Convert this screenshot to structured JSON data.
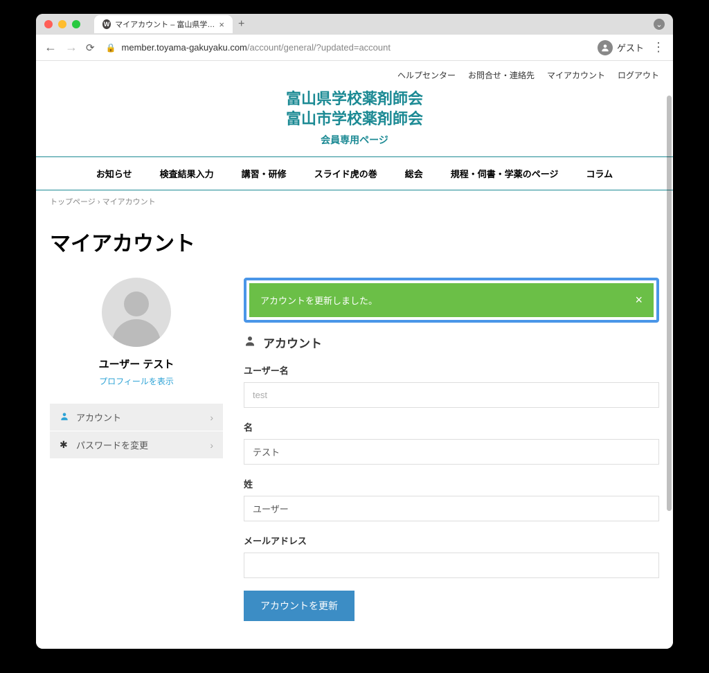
{
  "browser": {
    "tab_title": "マイアカウント – 富山県学校薬剤",
    "url_host": "member.toyama-gakuyaku.com",
    "url_path": "/account/general/?updated=account",
    "profile_label": "ゲスト"
  },
  "topnav": [
    "ヘルプセンター",
    "お問合せ・連絡先",
    "マイアカウント",
    "ログアウト"
  ],
  "header": {
    "line1": "富山県学校薬剤師会",
    "line2": "富山市学校薬剤師会",
    "sub": "会員専用ページ"
  },
  "mainnav": [
    "お知らせ",
    "検査結果入力",
    "講習・研修",
    "スライド虎の巻",
    "総会",
    "規程・伺書・学薬のページ",
    "コラム"
  ],
  "breadcrumb": {
    "home": "トップページ",
    "sep": "›",
    "current": "マイアカウント"
  },
  "page_title": "マイアカウント",
  "sidebar": {
    "username": "ユーザー テスト",
    "view_profile": "プロフィールを表示",
    "menu": [
      {
        "label": "アカウント"
      },
      {
        "label": "パスワードを変更"
      }
    ]
  },
  "alert": {
    "message": "アカウントを更新しました。"
  },
  "section": {
    "title": "アカウント"
  },
  "form": {
    "username_label": "ユーザー名",
    "username_value": "test",
    "firstname_label": "名",
    "firstname_value": "テスト",
    "lastname_label": "姓",
    "lastname_value": "ユーザー",
    "email_label": "メールアドレス",
    "email_value": "",
    "submit": "アカウントを更新"
  }
}
